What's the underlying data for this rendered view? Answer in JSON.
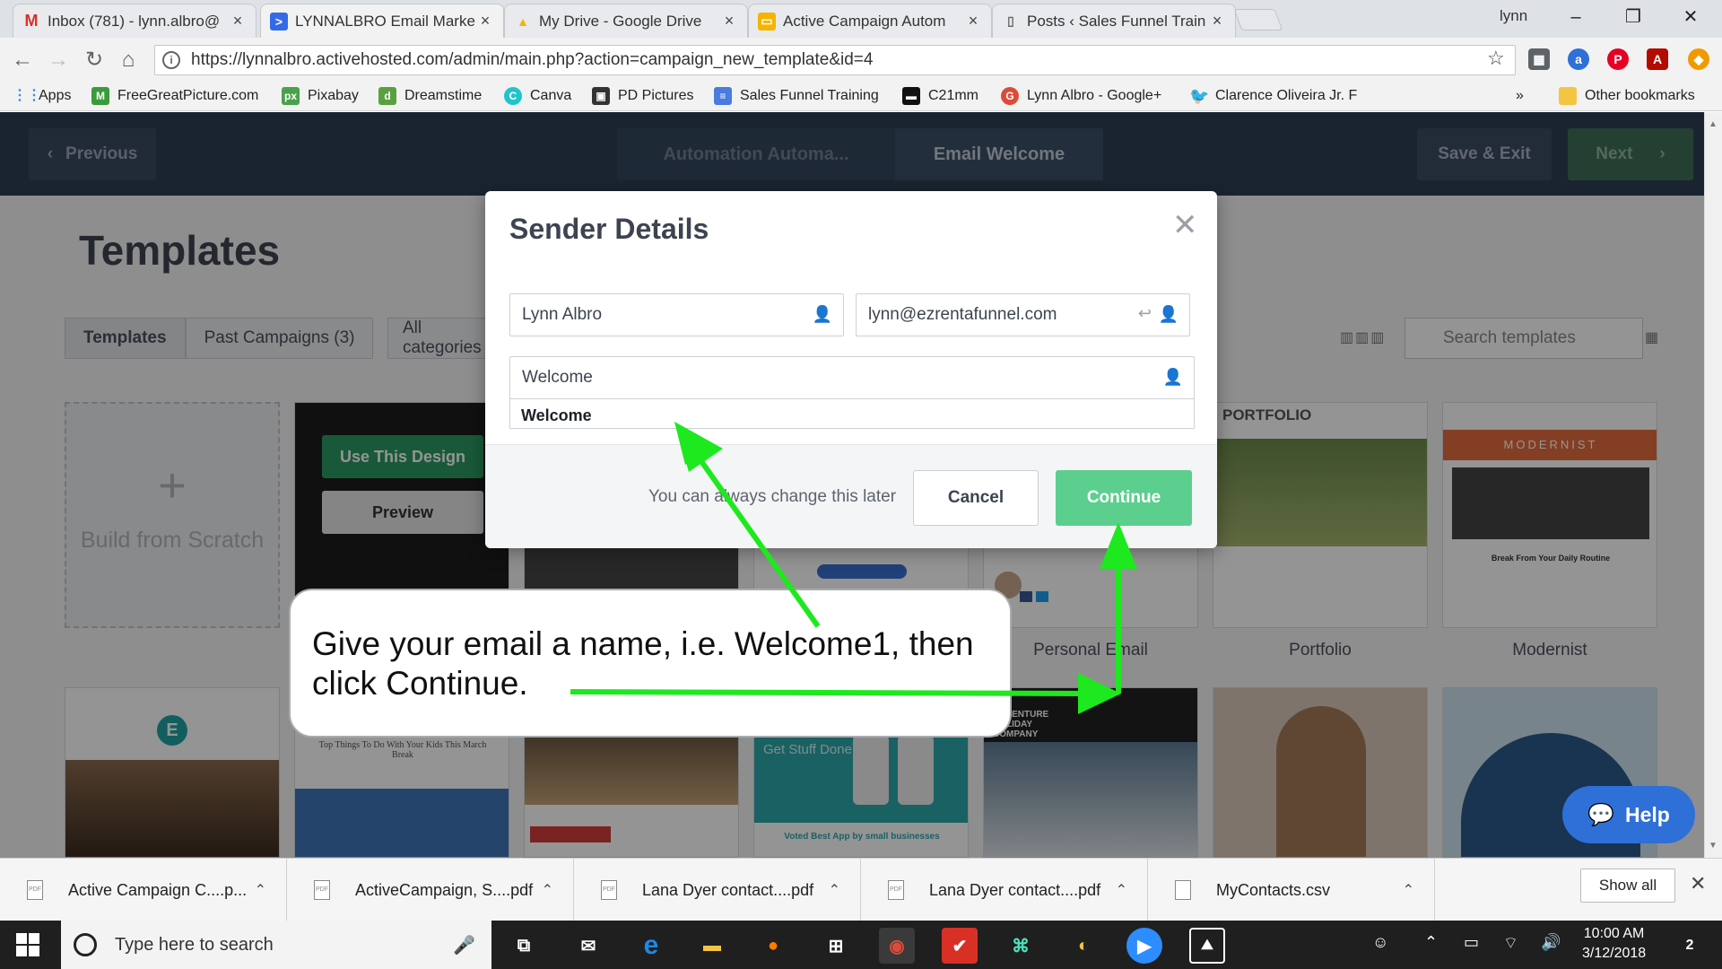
{
  "browser": {
    "tabs": [
      {
        "title": "Inbox (781) - lynn.albro@",
        "icon": "gmail-icon"
      },
      {
        "title": "LYNNALBRO Email Marke",
        "icon": "activecampaign-icon"
      },
      {
        "title": "My Drive - Google Drive",
        "icon": "drive-icon"
      },
      {
        "title": "Active Campaign Autom",
        "icon": "slides-icon"
      },
      {
        "title": "Posts ‹ Sales Funnel Train",
        "icon": "page-icon"
      }
    ],
    "profile": "lynn",
    "url": "https://lynnalbro.activehosted.com/admin/main.php?action=campaign_new_template&id=4",
    "bookmarks": [
      "Apps",
      "FreeGreatPicture.com",
      "Pixabay",
      "Dreamstime",
      "Canva",
      "PD Pictures",
      "Sales Funnel Training",
      "C21mm",
      "Lynn Albro - Google+",
      "Clarence Oliveira Jr. F"
    ],
    "bookmarks_more": "»",
    "other_bookmarks": "Other bookmarks"
  },
  "app": {
    "prev_label": "Previous",
    "crumb_1": "Automation Automa...",
    "crumb_2": "Email Welcome",
    "save_exit_label": "Save & Exit",
    "next_label": "Next",
    "heading": "Templates",
    "filter_tabs": [
      "Templates",
      "Past Campaigns (3)"
    ],
    "all_categories": "All categories",
    "search_placeholder": "Search templates",
    "build_from_scratch": "Build from Scratch",
    "use_this_design": "Use This Design",
    "preview": "Preview",
    "card_labels": [
      "Personal Email",
      "Portfolio",
      "Modernist"
    ],
    "card_texts": {
      "portfolio": "PORTFOLIO",
      "modernist": "MODERNIST",
      "modernist_tagline": "Break From Your Daily Routine",
      "kids": "Top Things To Do With Your Kids This March Break",
      "get_stuff_done": "Get Stuff Done.",
      "voted_best": "Voted Best App by small businesses",
      "adventure": "ADVENTURE HOLIDAY COMPANY"
    },
    "help_label": "Help"
  },
  "modal": {
    "title": "Sender Details",
    "from_name": "Lynn Albro",
    "from_email": "lynn@ezrentafunnel.com",
    "subject_value": "Welcome",
    "suggestion": "Welcome",
    "note": "You can always change this later",
    "cancel_label": "Cancel",
    "continue_label": "Continue"
  },
  "callout": {
    "text": "Give your email a name, i.e. Welcome1, then click Continue."
  },
  "downloads": [
    "Active Campaign C....p...",
    "ActiveCampaign, S....pdf",
    "Lana Dyer contact....pdf",
    "Lana Dyer contact....pdf",
    "MyContacts.csv"
  ],
  "downloads_show_all": "Show all",
  "taskbar": {
    "search_placeholder": "Type here to search",
    "time": "10:00 AM",
    "date": "3/12/2018",
    "notifications": "2"
  },
  "colors": {
    "appbar": "#2d3e53",
    "continue": "#5ccf8f",
    "arrow": "#1ee81e",
    "help": "#2f6fd8"
  }
}
